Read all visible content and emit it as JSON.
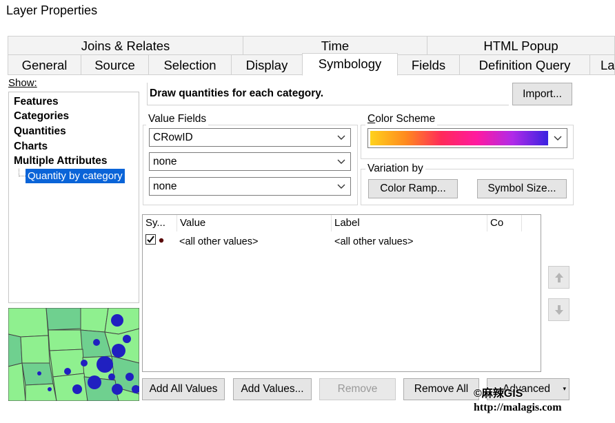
{
  "window": {
    "title": "Layer Properties"
  },
  "tabs": {
    "row1": [
      "Joins & Relates",
      "Time",
      "HTML Popup"
    ],
    "row2": [
      "General",
      "Source",
      "Selection",
      "Display",
      "Symbology",
      "Fields",
      "Definition Query",
      "La"
    ],
    "active": "Symbology"
  },
  "show": {
    "label": "Show:",
    "items": [
      "Features",
      "Categories",
      "Quantities",
      "Charts",
      "Multiple Attributes"
    ],
    "subitem": "Quantity by category"
  },
  "main": {
    "description": "Draw quantities for each category.",
    "import_label": "Import...",
    "value_fields": {
      "label": "Value Fields",
      "values": [
        "CRowID",
        "none",
        "none"
      ]
    },
    "color_scheme": {
      "label": "Color Scheme",
      "colors": [
        "#ffd21c",
        "#ff8a1e",
        "#ff2a5a",
        "#ff1aa0",
        "#b02be8",
        "#3a22e0"
      ]
    },
    "variation": {
      "label": "Variation by",
      "color_ramp": "Color Ramp...",
      "symbol_size": "Symbol Size..."
    },
    "table": {
      "headers": [
        "Sy...",
        "Value",
        "Label",
        "Co"
      ],
      "rows": [
        {
          "checked": true,
          "value": "<all other values>",
          "label": "<all other values>"
        }
      ]
    },
    "buttons": {
      "add_all": "Add All Values",
      "add_values": "Add Values...",
      "remove": "Remove",
      "remove_all": "Remove All",
      "advanced": "Advanced"
    }
  },
  "watermark": {
    "line1": "©麻辣GIS",
    "line2": "http://malagis.com"
  },
  "map_colors": {
    "land": "#8ff08f",
    "land2": "#6fd08f",
    "border": "#444444",
    "dot": "#2020c0"
  }
}
